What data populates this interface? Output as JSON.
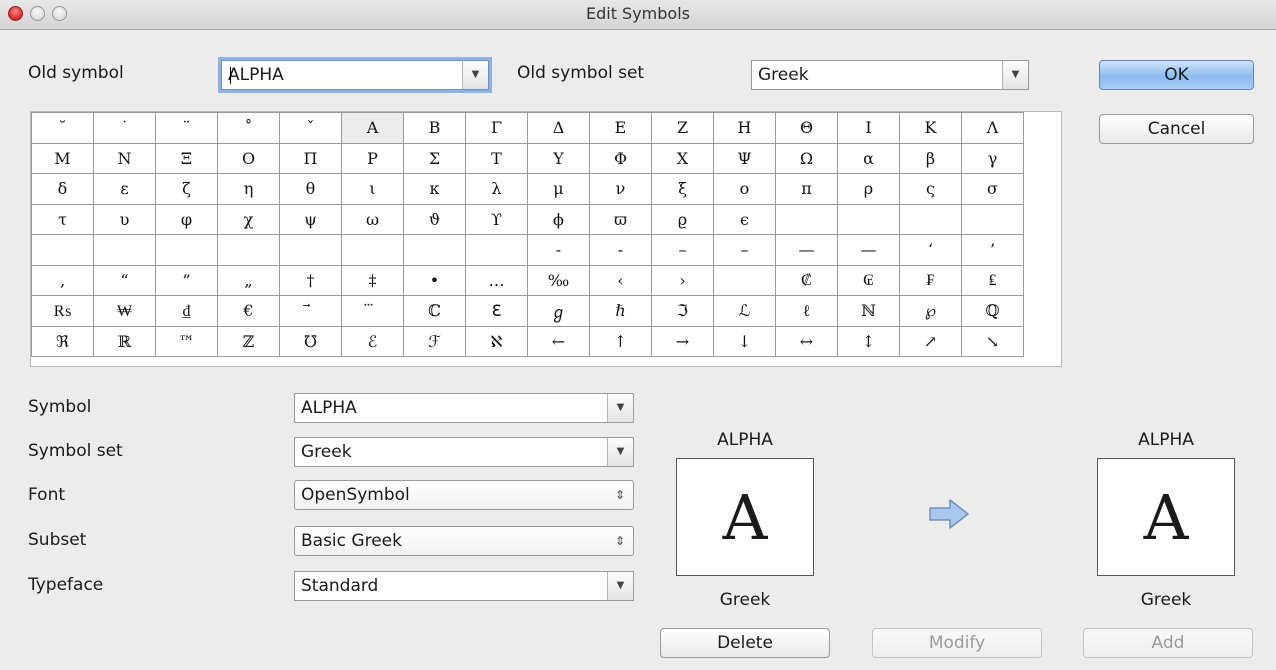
{
  "window": {
    "title": "Edit Symbols"
  },
  "top": {
    "old_symbol_label": "Old symbol",
    "old_symbol_value": "ALPHA",
    "old_symbol_set_label": "Old symbol set",
    "old_symbol_set_value": "Greek"
  },
  "buttons": {
    "ok": "OK",
    "cancel": "Cancel",
    "delete": "Delete",
    "modify": "Modify",
    "add": "Add"
  },
  "grid": {
    "selected": [
      0,
      5
    ],
    "rows": [
      [
        "˘",
        "˙",
        "¨",
        "˚",
        "ˇ",
        "Α",
        "Β",
        "Γ",
        "Δ",
        "Ε",
        "Ζ",
        "Η",
        "Θ",
        "Ι",
        "Κ",
        "Λ"
      ],
      [
        "Μ",
        "Ν",
        "Ξ",
        "Ο",
        "Π",
        "Ρ",
        "Σ",
        "Τ",
        "Υ",
        "Φ",
        "Χ",
        "Ψ",
        "Ω",
        "α",
        "β",
        "γ"
      ],
      [
        "δ",
        "ε",
        "ζ",
        "η",
        "θ",
        "ι",
        "κ",
        "λ",
        "μ",
        "ν",
        "ξ",
        "ο",
        "π",
        "ρ",
        "ς",
        "σ"
      ],
      [
        "τ",
        "υ",
        "φ",
        "χ",
        "ψ",
        "ω",
        "ϑ",
        "ϒ",
        "ϕ",
        "ϖ",
        "ϱ",
        "ϵ",
        "",
        "",
        "",
        ""
      ],
      [
        "",
        "",
        "",
        "",
        "",
        "",
        "",
        "",
        "‐",
        "‑",
        "–",
        "–",
        "—",
        "—",
        "‘",
        "’"
      ],
      [
        "‚",
        "“",
        "”",
        "„",
        "†",
        "‡",
        "•",
        "…",
        "‰",
        "‹",
        "›",
        "",
        "₡",
        "₢",
        "₣",
        "₤"
      ],
      [
        "₨",
        "₩",
        "₫",
        "€",
        "⃗",
        "⃛",
        "ℂ",
        "ℇ",
        "ℊ",
        "ℏ",
        "ℑ",
        "ℒ",
        "ℓ",
        "ℕ",
        "℘",
        "ℚ"
      ],
      [
        "ℜ",
        "ℝ",
        "™",
        "ℤ",
        "℧",
        "ℰ",
        "ℱ",
        "ℵ",
        "←",
        "↑",
        "→",
        "↓",
        "↔",
        "↕",
        "↗",
        "↘"
      ]
    ]
  },
  "form": {
    "symbol_label": "Symbol",
    "symbol_value": "ALPHA",
    "symbol_set_label": "Symbol set",
    "symbol_set_value": "Greek",
    "font_label": "Font",
    "font_value": "OpenSymbol",
    "subset_label": "Subset",
    "subset_value": "Basic Greek",
    "typeface_label": "Typeface",
    "typeface_value": "Standard"
  },
  "preview_old": {
    "name": "ALPHA",
    "glyph": "Α",
    "set": "Greek"
  },
  "preview_new": {
    "name": "ALPHA",
    "glyph": "Α",
    "set": "Greek"
  },
  "icons": {
    "dropdown": "chevron-down-icon",
    "popup": "updown-arrows-icon",
    "transfer": "right-arrow-icon"
  },
  "colors": {
    "default_button": "#8ebbee",
    "focus_ring": "#8db2e3",
    "arrow_fill": "#a9c7ea"
  }
}
